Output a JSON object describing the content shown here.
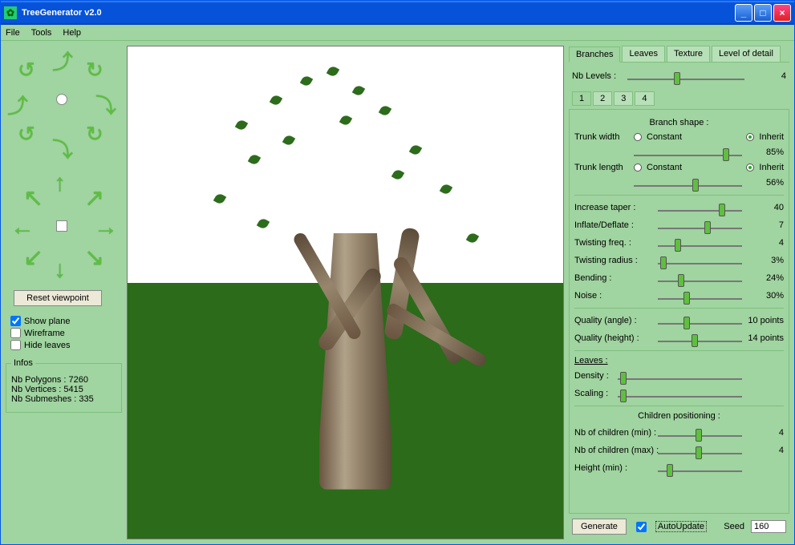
{
  "window": {
    "title": "TreeGenerator v2.0"
  },
  "menu": {
    "file": "File",
    "tools": "Tools",
    "help": "Help"
  },
  "left": {
    "reset": "Reset viewpoint",
    "show_plane": "Show plane",
    "wireframe": "Wireframe",
    "hide_leaves": "Hide leaves",
    "infos_header": "Infos",
    "polys_label": "Nb Polygons :",
    "polys_value": "7260",
    "verts_label": "Nb Vertices :",
    "verts_value": "5415",
    "subm_label": "Nb Submeshes :",
    "subm_value": "335"
  },
  "tabs": {
    "branches": "Branches",
    "leaves": "Leaves",
    "texture": "Texture",
    "lod": "Level of detail"
  },
  "nb_levels_label": "Nb Levels :",
  "nb_levels_value": "4",
  "subtabs": {
    "t1": "1",
    "t2": "2",
    "t3": "3",
    "t4": "4"
  },
  "section": {
    "branch_shape": "Branch shape :",
    "children_pos": "Children positioning :"
  },
  "params": {
    "trunk_width_label": "Trunk width",
    "constant": "Constant",
    "inherit": "Inherit",
    "trunk_width_val": "85%",
    "trunk_length_label": "Trunk length",
    "trunk_length_val": "56%",
    "increase_taper_label": "Increase taper :",
    "increase_taper_val": "40",
    "inflate_label": "Inflate/Deflate :",
    "inflate_val": "7",
    "twist_freq_label": "Twisting freq. :",
    "twist_freq_val": "4",
    "twist_radius_label": "Twisting radius :",
    "twist_radius_val": "3%",
    "bending_label": "Bending :",
    "bending_val": "24%",
    "noise_label": "Noise :",
    "noise_val": "30%",
    "qual_angle_label": "Quality (angle) :",
    "qual_angle_val": "10 points",
    "qual_height_label": "Quality (height) :",
    "qual_height_val": "14 points",
    "leaves_hdr": "Leaves :",
    "density_label": "Density :",
    "scaling_label": "Scaling :",
    "nb_children_min_label": "Nb of children (min) :",
    "nb_children_min_val": "4",
    "nb_children_max_label": "Nb of children (max) :",
    "nb_children_max_val": "4",
    "height_min_label": "Height (min) :"
  },
  "bottom": {
    "generate": "Generate",
    "autoupdate": "AutoUpdate",
    "seed_label": "Seed",
    "seed_value": "160"
  }
}
